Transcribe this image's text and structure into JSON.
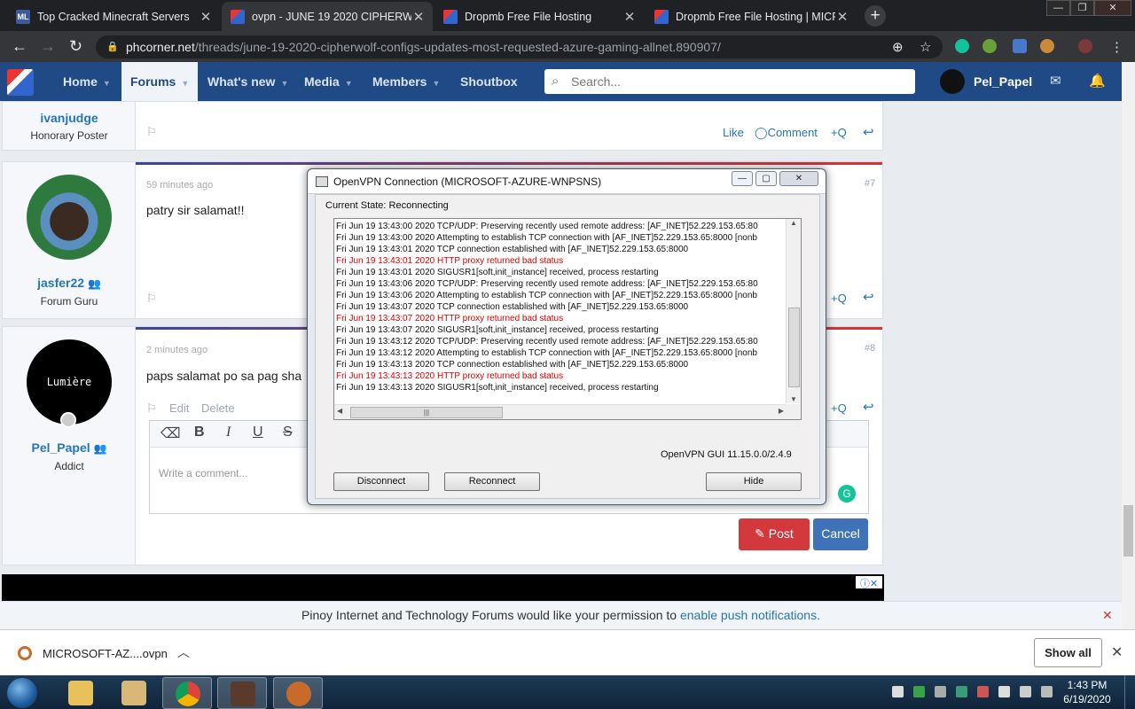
{
  "browser": {
    "tabs": [
      {
        "title": "Top Cracked Minecraft Servers",
        "favicon_text": "ML",
        "favicon_color": "#3b5b9a"
      },
      {
        "title": "ovpn - JUNE 19 2020 CIPHERW",
        "favicon_color": "#3e6fbf"
      },
      {
        "title": "Dropmb Free File Hosting",
        "favicon_color": "#3e6fbf"
      },
      {
        "title": "Dropmb Free File Hosting | MICR",
        "favicon_color": "#3e6fbf"
      }
    ],
    "new_tab_label": "+",
    "url_host": "phcorner.net",
    "url_path": "/threads/june-19-2020-cipherwolf-configs-updates-most-requested-azure-gaming-allnet.890907/"
  },
  "site": {
    "nav": {
      "home": "Home",
      "forums": "Forums",
      "whats_new": "What's new",
      "media": "Media",
      "members": "Members",
      "shoutbox": "Shoutbox"
    },
    "search_placeholder": "Search...",
    "username": "Pel_Papel",
    "posts": [
      {
        "author": "ivanjudge",
        "rank": "Honorary Poster",
        "actions": {
          "like": "Like",
          "comment": "Comment",
          "quote": "+Q"
        }
      },
      {
        "author": "jasfer22",
        "rank": "Forum Guru",
        "date": "59 minutes ago",
        "number": "#7",
        "body": "patry sir salamat!!",
        "quote": "+Q"
      },
      {
        "author": "Pel_Papel",
        "rank": "Addict",
        "avatar_text": "Lumière",
        "date": "2 minutes ago",
        "number": "#8",
        "body": "paps salamat po sa pag sha",
        "edit": "Edit",
        "delete": "Delete",
        "quote": "+Q"
      }
    ],
    "editor": {
      "placeholder": "Write a comment...",
      "post_label": "Post",
      "cancel_label": "Cancel"
    },
    "push_text": "Pinoy Internet and Technology Forums would like your permission to ",
    "push_link": "enable push notifications."
  },
  "openvpn": {
    "title": "OpenVPN Connection (MICROSOFT-AZURE-WNPSNS)",
    "state": "Current State: Reconnecting",
    "log": [
      {
        "text": "Fri Jun 19 13:43:00 2020 TCP/UDP: Preserving recently used remote address: [AF_INET]52.229.153.65:80",
        "error": false
      },
      {
        "text": "Fri Jun 19 13:43:00 2020 Attempting to establish TCP connection with [AF_INET]52.229.153.65:8000 [nonb",
        "error": false
      },
      {
        "text": "Fri Jun 19 13:43:01 2020 TCP connection established with [AF_INET]52.229.153.65:8000",
        "error": false
      },
      {
        "text": "Fri Jun 19 13:43:01 2020 HTTP proxy returned bad status",
        "error": true
      },
      {
        "text": "Fri Jun 19 13:43:01 2020 SIGUSR1[soft,init_instance] received, process restarting",
        "error": false
      },
      {
        "text": "Fri Jun 19 13:43:06 2020 TCP/UDP: Preserving recently used remote address: [AF_INET]52.229.153.65:80",
        "error": false
      },
      {
        "text": "Fri Jun 19 13:43:06 2020 Attempting to establish TCP connection with [AF_INET]52.229.153.65:8000 [nonb",
        "error": false
      },
      {
        "text": "Fri Jun 19 13:43:07 2020 TCP connection established with [AF_INET]52.229.153.65:8000",
        "error": false
      },
      {
        "text": "Fri Jun 19 13:43:07 2020 HTTP proxy returned bad status",
        "error": true
      },
      {
        "text": "Fri Jun 19 13:43:07 2020 SIGUSR1[soft,init_instance] received, process restarting",
        "error": false
      },
      {
        "text": "Fri Jun 19 13:43:12 2020 TCP/UDP: Preserving recently used remote address: [AF_INET]52.229.153.65:80",
        "error": false
      },
      {
        "text": "Fri Jun 19 13:43:12 2020 Attempting to establish TCP connection with [AF_INET]52.229.153.65:8000 [nonb",
        "error": false
      },
      {
        "text": "Fri Jun 19 13:43:13 2020 TCP connection established with [AF_INET]52.229.153.65:8000",
        "error": false
      },
      {
        "text": "Fri Jun 19 13:43:13 2020 HTTP proxy returned bad status",
        "error": true
      },
      {
        "text": "Fri Jun 19 13:43:13 2020 SIGUSR1[soft,init_instance] received, process restarting",
        "error": false
      }
    ],
    "version": "OpenVPN GUI 11.15.0.0/2.4.9",
    "buttons": {
      "disconnect": "Disconnect",
      "reconnect": "Reconnect",
      "hide": "Hide"
    },
    "error_color": "#dd0000"
  },
  "downloads": {
    "file": "MICROSOFT-AZ....ovpn",
    "show_all": "Show all"
  },
  "taskbar": {
    "time": "1:43 PM",
    "date": "6/19/2020"
  },
  "colors": {
    "site_nav": "#1f4a86",
    "link": "#2577b1",
    "post_button": "#d2383c",
    "cancel_button": "#3f72b8"
  }
}
